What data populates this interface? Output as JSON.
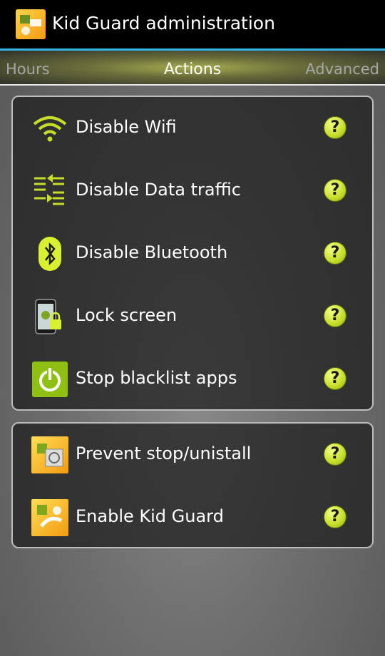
{
  "header": {
    "title": "Kid Guard administration"
  },
  "tabs": [
    {
      "label": "Hours"
    },
    {
      "label": "Actions"
    },
    {
      "label": "Advanced"
    }
  ],
  "group1": [
    {
      "label": "Disable Wifi",
      "icon": "wifi-icon"
    },
    {
      "label": "Disable Data traffic",
      "icon": "data-traffic-icon"
    },
    {
      "label": "Disable Bluetooth",
      "icon": "bluetooth-icon"
    },
    {
      "label": "Lock screen",
      "icon": "lock-screen-icon"
    },
    {
      "label": "Stop blacklist apps",
      "icon": "power-icon"
    }
  ],
  "group2": [
    {
      "label": "Prevent stop/unistall",
      "icon": "prevent-uninstall-icon"
    },
    {
      "label": "Enable Kid Guard",
      "icon": "kid-guard-icon"
    }
  ],
  "help_symbol": "?",
  "colors": {
    "accent_lime": "#c6dd2a",
    "tab_indicator": "#33b5e5"
  }
}
